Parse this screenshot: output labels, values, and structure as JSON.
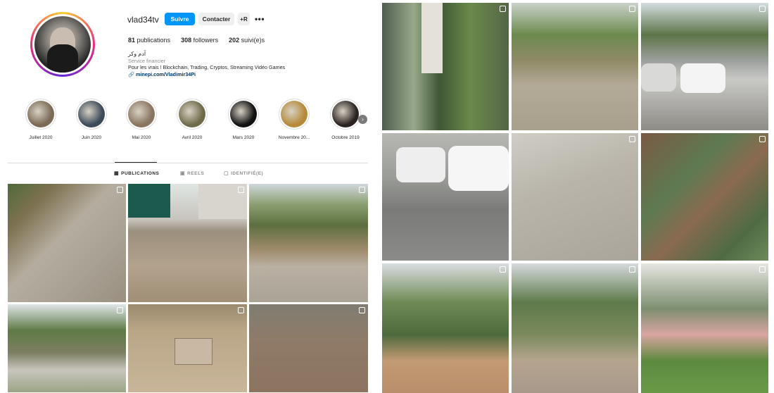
{
  "profile": {
    "username": "vlad34tv",
    "follow_label": "Suivre",
    "contact_label": "Contacter",
    "add_user_label": "+R",
    "more_label": "•••",
    "stats": {
      "posts_count": "81",
      "posts_label": "publications",
      "followers_count": "308",
      "followers_label": "followers",
      "following_count": "202",
      "following_label": "suivi(e)s"
    },
    "bio": {
      "name": "آدم وكر",
      "category": "Service financier",
      "text": "Pour les vrais ! Blockchain, Trading, Cryptos, Streaming Vidéo Games",
      "link": "minepi.com/Vladimir34Pi"
    }
  },
  "highlights": [
    {
      "label": "Juillet 2020",
      "color": "#7b6a55"
    },
    {
      "label": "Juin 2020",
      "color": "#3c4a5a"
    },
    {
      "label": "Mai 2020",
      "color": "#8a7560"
    },
    {
      "label": "Avril 2020",
      "color": "#6e6a4a"
    },
    {
      "label": "Mars 2020",
      "color": "#111111"
    },
    {
      "label": "Novembre 20...",
      "color": "#b58a3a"
    },
    {
      "label": "Octobre 2019",
      "color": "#2b2320"
    }
  ],
  "tabs": [
    {
      "label": "PUBLICATIONS",
      "icon": "grid-icon"
    },
    {
      "label": "REELS",
      "icon": "reels-icon"
    },
    {
      "label": "IDENTIFIÉ(E)",
      "icon": "tagged-icon"
    }
  ],
  "colors": {
    "accent": "#0095f6",
    "text": "#262626",
    "muted": "#8e8e8e",
    "link": "#00376b"
  }
}
